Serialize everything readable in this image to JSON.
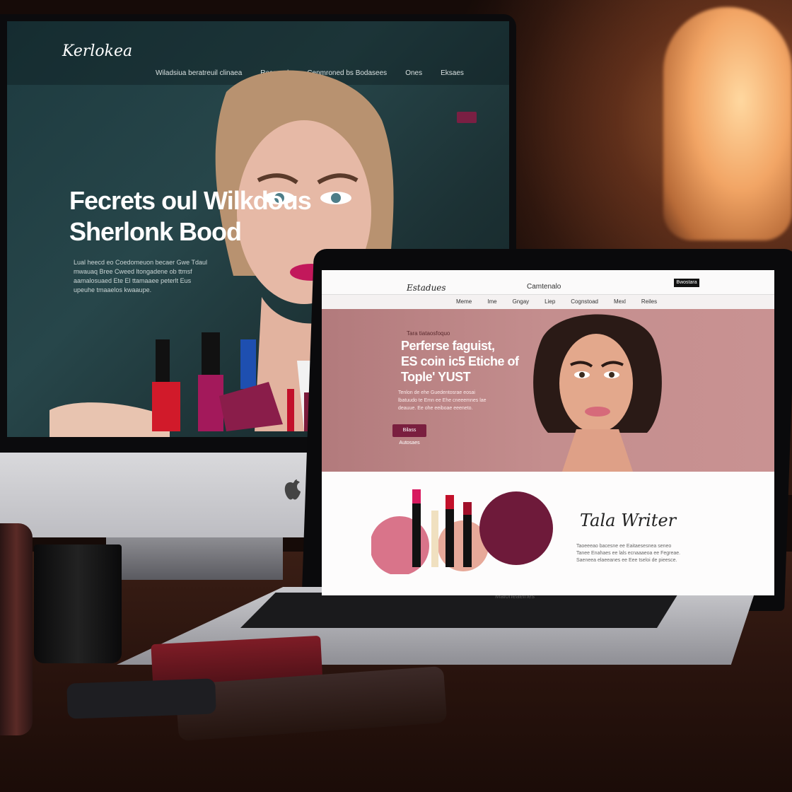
{
  "imac": {
    "site_logo": "Kerlokea",
    "nav": [
      "Wiladsiua beratreuil clinaea",
      "Resnend",
      "Cenmroned bs Bodasees",
      "Ones",
      "Eksaes"
    ],
    "hero_title_line1": "Fecrets oul Wilkdous",
    "hero_title_line2": "Sherlonk Bood",
    "hero_body": "Lual heecd eo Coedomeuon becaer Gwe Tdaul mwauaq Bree Cweed ltongadene ob ttmsf aamalosuaed Ete El ttamaaee peterlt Eus upeuhe tmaaelos kwaaupe.",
    "apple_logo": "apple-icon",
    "colors": {
      "accent": "#7a1f43",
      "screen_bg": "#1d3a3f"
    }
  },
  "laptop": {
    "site_logo": "Estadues",
    "brand_center": "Camtenalo",
    "header_button": "Bwostara",
    "nav": [
      "Meme",
      "Ime",
      "Gngay",
      "Liep",
      "Cognstoad",
      "Mexl",
      "Reiles"
    ],
    "hero_kicker": "Tara tiataosfoquo",
    "hero_title_line1": "Perferse faguist,",
    "hero_title_line2": "ES coin ic5 Etiche of",
    "hero_title_line3": "Tople' YUST",
    "hero_body": "Tenlon de ehe Guedentosrae eosai lbatuudo te Emn ee Ehe cneeemnes lae deauue. Ee ohe eeiboae eeeneto.",
    "hero_cta": "Bilass Autosaes",
    "signature": "Tala Writer",
    "lower_body": "Taoeeeao bacesne ee Eaitaesesnea seneo Tanee Enahaes ee lals ecnaaaeoa ee Fegreae. Saeneea elaeeanes ee Eee tseloi de pieesce.",
    "keyboard_brand": "Maloneaelnes",
    "colors": {
      "hero_bg": "#c48e8e",
      "cta": "#7a1f3f"
    }
  }
}
